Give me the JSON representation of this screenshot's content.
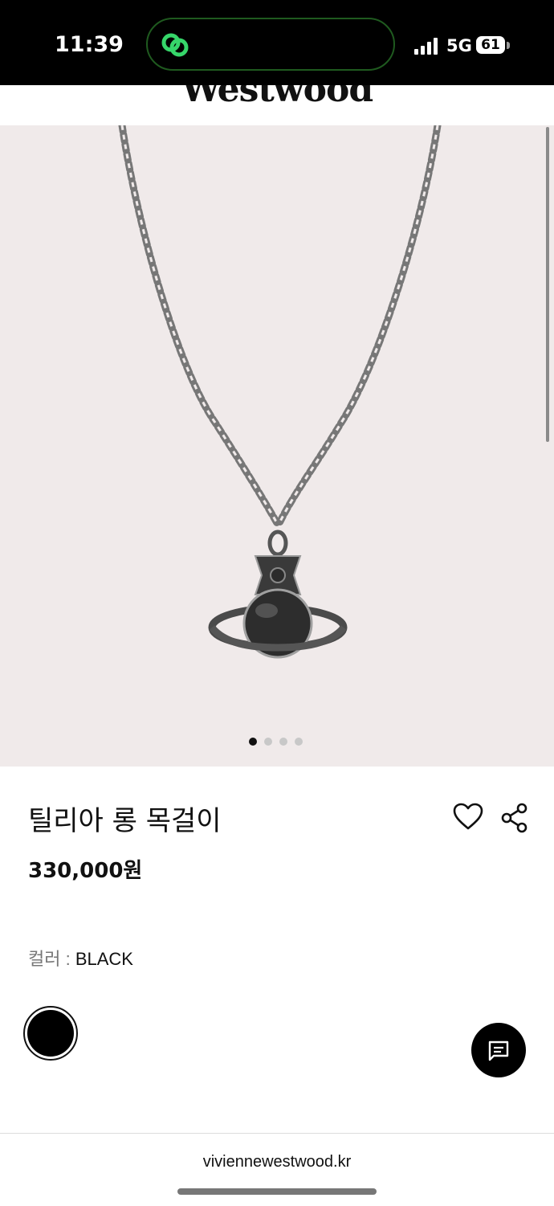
{
  "status_bar": {
    "time": "11:39",
    "network": "5G",
    "battery": "61",
    "island_icon": "link-rings-icon"
  },
  "header": {
    "brand": "Westwood"
  },
  "gallery": {
    "image": "necklace-with-orb-pendant",
    "slide_count": 4,
    "active_slide": 1
  },
  "product": {
    "title": "틸리아 롱 목걸이",
    "price": "330,000원",
    "color_label": "컬러",
    "color_separator": " : ",
    "color_value": "BLACK",
    "swatch_color": "#000000"
  },
  "icons": {
    "heart": "heart-icon",
    "share": "share-icon",
    "chat": "chat-icon"
  },
  "browser": {
    "url": "viviennewestwood.kr"
  }
}
